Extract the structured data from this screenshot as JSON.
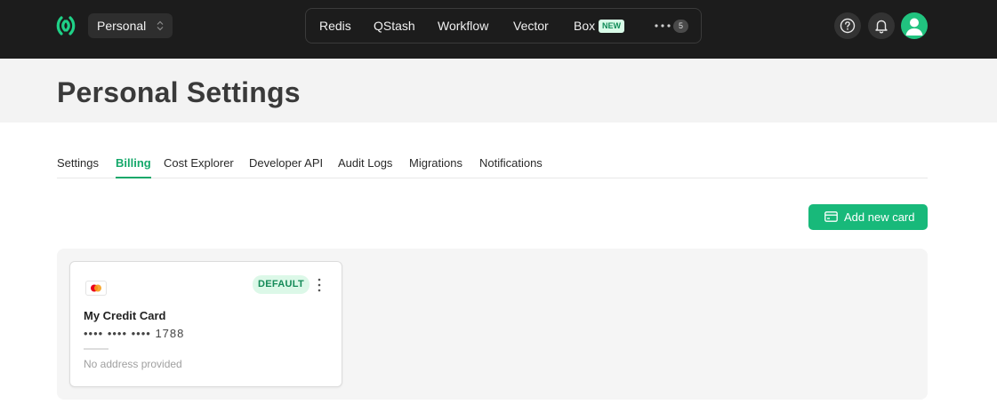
{
  "topbar": {
    "workspace": "Personal",
    "nav": [
      {
        "label": "Redis"
      },
      {
        "label": "QStash"
      },
      {
        "label": "Workflow"
      },
      {
        "label": "Vector"
      },
      {
        "label": "Box",
        "badge": "NEW"
      }
    ],
    "more_count": "5"
  },
  "page": {
    "title": "Personal Settings"
  },
  "tabs": [
    {
      "label": "Settings"
    },
    {
      "label": "Billing",
      "active": true
    },
    {
      "label": "Cost Explorer"
    },
    {
      "label": "Developer API"
    },
    {
      "label": "Audit Logs"
    },
    {
      "label": "Migrations"
    },
    {
      "label": "Notifications"
    }
  ],
  "billing": {
    "add_card_label": "Add new card",
    "card": {
      "name": "My Credit Card",
      "number": "•••• •••• •••• 1788",
      "badge": "DEFAULT",
      "address": "No address provided",
      "brand_icon": "mastercard-icon"
    }
  },
  "colors": {
    "brand": "#18b97a",
    "topbar": "#1c1c1c",
    "hero": "#f3f3f3"
  }
}
